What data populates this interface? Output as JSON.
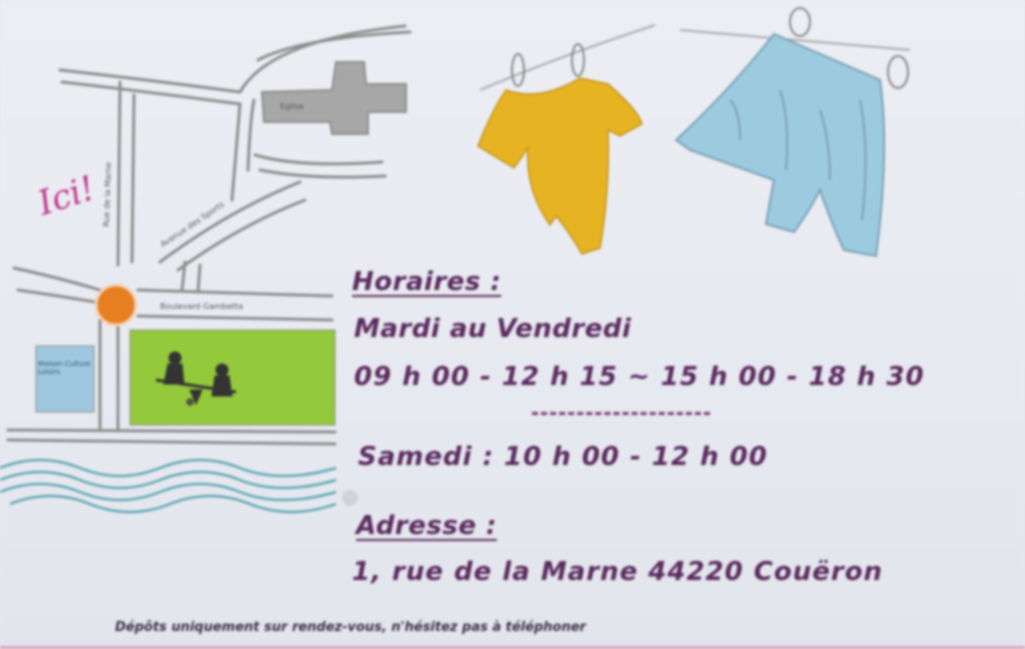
{
  "card": {
    "ici_label": "Ici!",
    "map": {
      "street_vertical": "Rue de la Marne",
      "street_diagonal": "Avenue des Sports",
      "boulevard": "Boulevard Gambetta",
      "church": "Eglise",
      "building": "Maison Culture Loisirs"
    },
    "hours_title": "Horaires :",
    "weekdays_label": "Mardi au Vendredi",
    "weekdays_hours": "09 h 00 - 12 h 15  ~  15 h 00 - 18 h 30",
    "saturday_hours": "Samedi :  10 h 00 - 12 h 00",
    "address_title": "Adresse :",
    "address_value": "1, rue de la Marne 44220 Couëron",
    "footer_note": "Dépôts uniquement sur rendez-vous, n'hésitez pas à téléphoner",
    "colors": {
      "text": "#5a2a5e",
      "onesie": "#e6b322",
      "shorts": "#9ccbe0",
      "park": "#93c93a",
      "roundabout": "#e67e22",
      "ici": "#c0368c",
      "water": "#5fa7b3"
    },
    "icons": [
      "clothesline-onesie-icon",
      "clothesline-shorts-icon",
      "seesaw-kids-icon",
      "water-waves-icon",
      "church-icon"
    ]
  }
}
